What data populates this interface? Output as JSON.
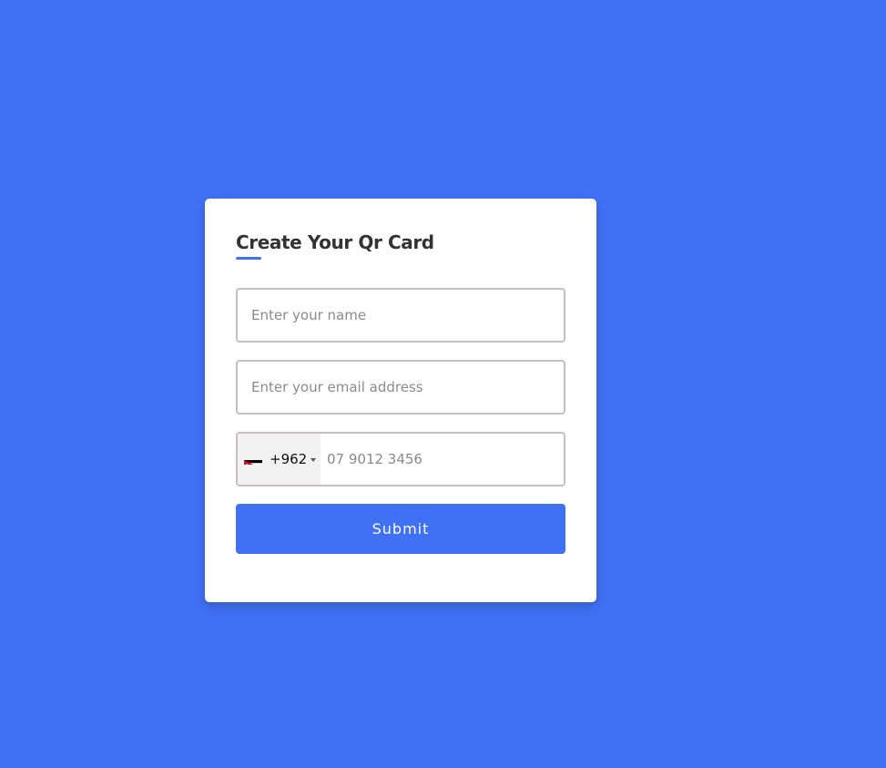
{
  "form": {
    "title": "Create Your Qr Card",
    "name": {
      "placeholder": "Enter your name",
      "value": ""
    },
    "email": {
      "placeholder": "Enter your email address",
      "value": ""
    },
    "phone": {
      "country_flag": "jordan-flag-icon",
      "dial_code": "+962",
      "placeholder": "07 9012 3456",
      "value": ""
    },
    "submit_label": "Submit"
  },
  "colors": {
    "background": "#4070f4",
    "accent": "#4070f4",
    "card": "#ffffff",
    "input_border": "#c7bebe",
    "title": "#333333"
  }
}
